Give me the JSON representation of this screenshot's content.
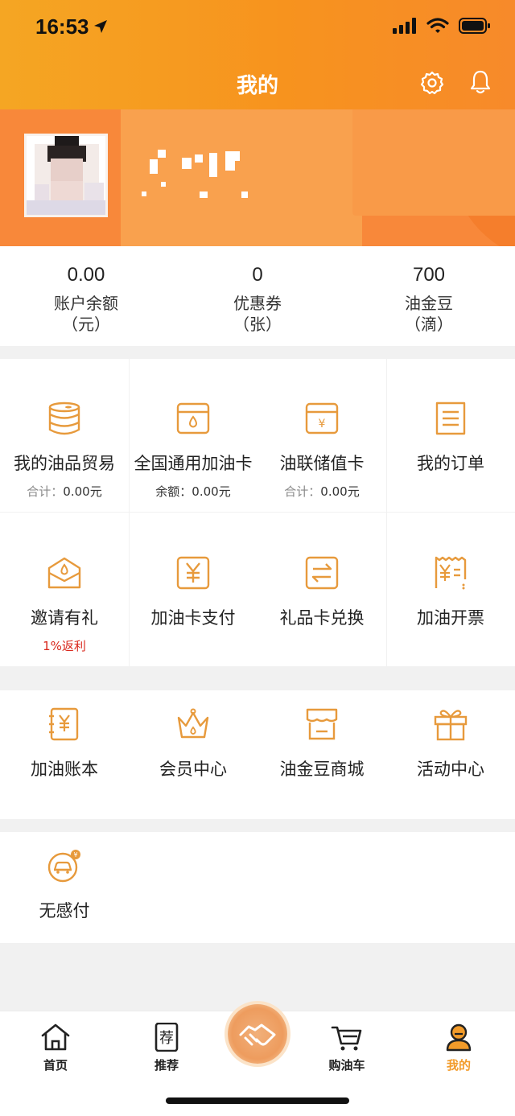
{
  "status_bar": {
    "time": "16:53"
  },
  "nav": {
    "title": "我的"
  },
  "stats": [
    {
      "value": "0.00",
      "label": "账户余额",
      "unit": "（元）"
    },
    {
      "value": "0",
      "label": "优惠券",
      "unit": "（张）"
    },
    {
      "value": "700",
      "label": "油金豆",
      "unit": "（滴）"
    }
  ],
  "grid1": [
    {
      "label": "我的油品贸易",
      "sub_prefix": "合计：",
      "sub_value": "0.00元",
      "icon": "barrel-icon"
    },
    {
      "label": "全国通用加油卡",
      "sub_prefix": "余额：",
      "sub_value": "0.00元",
      "icon": "fuel-card-icon"
    },
    {
      "label": "油联储值卡",
      "sub_prefix": "合计：",
      "sub_value": "0.00元",
      "icon": "yuan-card-icon"
    },
    {
      "label": "我的订单",
      "icon": "order-list-icon"
    },
    {
      "label": "邀请有礼",
      "sub_red": "1%返利",
      "icon": "envelope-gift-icon"
    },
    {
      "label": "加油卡支付",
      "icon": "yuan-pay-icon"
    },
    {
      "label": "礼品卡兑换",
      "icon": "exchange-icon"
    },
    {
      "label": "加油开票",
      "icon": "invoice-icon"
    }
  ],
  "grid2": [
    {
      "label": "加油账本",
      "icon": "ledger-icon"
    },
    {
      "label": "会员中心",
      "icon": "crown-icon"
    },
    {
      "label": "油金豆商城",
      "icon": "store-icon"
    },
    {
      "label": "活动中心",
      "icon": "gift-icon"
    }
  ],
  "grid3": [
    {
      "label": "无感付",
      "icon": "car-pay-icon"
    }
  ],
  "tabbar": [
    {
      "label": "首页",
      "icon": "home-icon"
    },
    {
      "label": "推荐",
      "icon": "recommend-icon"
    },
    {
      "label": "购油车",
      "icon": "cart-icon"
    },
    {
      "label": "我的",
      "icon": "profile-icon"
    }
  ],
  "colors": {
    "accent": "#f29b2a",
    "header_start": "#f5a623",
    "header_end": "#f78a2a",
    "red": "#d9271c"
  }
}
